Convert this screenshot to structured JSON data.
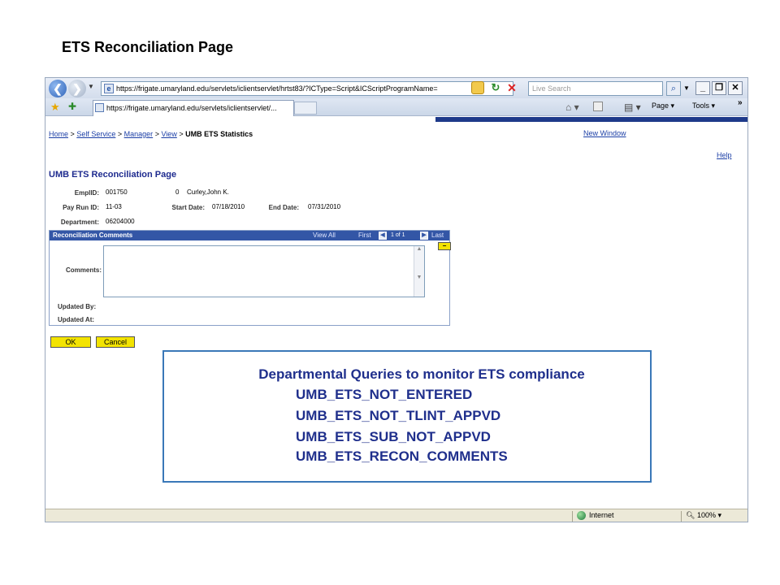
{
  "slide": {
    "title": "ETS Reconciliation Page"
  },
  "browser": {
    "nav": {
      "back": "❮",
      "forward": "❯",
      "dropdown": "▼"
    },
    "address_url": "https://frigate.umaryland.edu/servlets/iclientservlet/hrtst83/?ICType=Script&ICScriptProgramName=",
    "search_placeholder": "Live Search",
    "tab_title": "https://frigate.umaryland.edu/servlets/iclientservlet/...",
    "window_buttons": {
      "minimize": "_",
      "restore": "❐",
      "close": "✕"
    },
    "command_bar": {
      "page": "Page ▾",
      "tools": "Tools ▾",
      "more": "»"
    },
    "status": {
      "zone": "Internet",
      "zoom": "100%"
    }
  },
  "app": {
    "breadcrumb": {
      "home": "Home",
      "self_service": "Self Service",
      "manager": "Manager",
      "view": "View",
      "current": "UMB ETS Statistics",
      "sep": ">"
    },
    "new_window": "New Window",
    "help": "Help",
    "page_title": "UMB ETS Reconciliation Page",
    "fields": {
      "emplid_label": "EmplID:",
      "emplid_value": "001750",
      "empl_rcd": "0",
      "name": "Curley,John K.",
      "pay_run_label": "Pay Run ID:",
      "pay_run_value": "11-03",
      "start_date_label": "Start Date:",
      "start_date_value": "07/18/2010",
      "end_date_label": "End Date:",
      "end_date_value": "07/31/2010",
      "department_label": "Department:",
      "department_value": "06204000"
    },
    "recon": {
      "header": "Reconciliation Comments",
      "view_all": "View All",
      "first": "First",
      "page_count": "1 of 1",
      "last": "Last",
      "comments_label": "Comments:",
      "comments_value": "",
      "updated_by_label": "Updated By:",
      "updated_at_label": "Updated At:"
    },
    "buttons": {
      "ok": "OK",
      "cancel": "Cancel"
    }
  },
  "overlay": {
    "heading": "Departmental Queries to monitor ETS compliance",
    "queries": [
      "UMB_ETS_NOT_ENTERED",
      "UMB_ETS_NOT_TLINT_APPVD",
      "UMB_ETS_SUB_NOT_APPVD",
      "UMB_ETS_RECON_COMMENTS"
    ]
  },
  "colors": {
    "overlay_border": "#3a78b8",
    "overlay_text": "#1f2f8c",
    "ps_button": "#f3e300",
    "grid_header": "#3356a6"
  }
}
